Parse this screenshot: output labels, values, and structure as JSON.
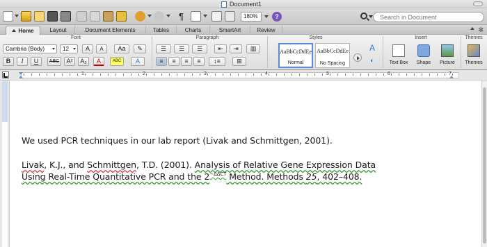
{
  "window": {
    "title": "Document1"
  },
  "toolbar": {
    "zoom": "180%",
    "help_glyph": "?",
    "search_placeholder": "Search in Document"
  },
  "tabs": [
    "Home",
    "Layout",
    "Document Elements",
    "Tables",
    "Charts",
    "SmartArt",
    "Review"
  ],
  "groups": {
    "font": "Font",
    "paragraph": "Paragraph",
    "styles": "Styles",
    "insert": "Insert",
    "themes": "Themes"
  },
  "font": {
    "family": "Cambria (Body)",
    "size": "12",
    "bold": "B",
    "italic": "I",
    "underline": "U",
    "strike": "ABC",
    "color_a": "A",
    "grow": "A",
    "shrink": "A"
  },
  "styles": [
    {
      "sample": "AaBbCcDdEe",
      "name": "Normal"
    },
    {
      "sample": "AaBbCcDdEe",
      "name": "No Spacing"
    }
  ],
  "insert": {
    "textbox": "Text Box",
    "shape": "Shape",
    "picture": "Picture"
  },
  "themes": {
    "label": "Themes"
  },
  "ruler": {
    "numbers": [
      "1",
      "2",
      "3",
      "4",
      "5",
      "6",
      "7",
      "8"
    ]
  },
  "accent": {
    "selected_style": "#5a8ad8",
    "help": "#7755bb",
    "spelling": "#dd3333",
    "grammar": "#2a9a2a"
  },
  "document": {
    "p1": "We used PCR techniques in our lab report (Livak and Schmittgen, 2001).",
    "ref": {
      "author1": "Livak",
      "seg1": ", K.J., and ",
      "author2": "Schmittgen",
      "seg2": ", T.D. (2001). ",
      "title_a": "Analysis of Relative Gene Expression Data",
      "title_b": "Using Real-Time Quantitative PCR and the 2",
      "sup": "−ΔΔCT",
      "title_c": " Method. Methods ",
      "volume": "25",
      "pages": ", 402–408."
    }
  }
}
